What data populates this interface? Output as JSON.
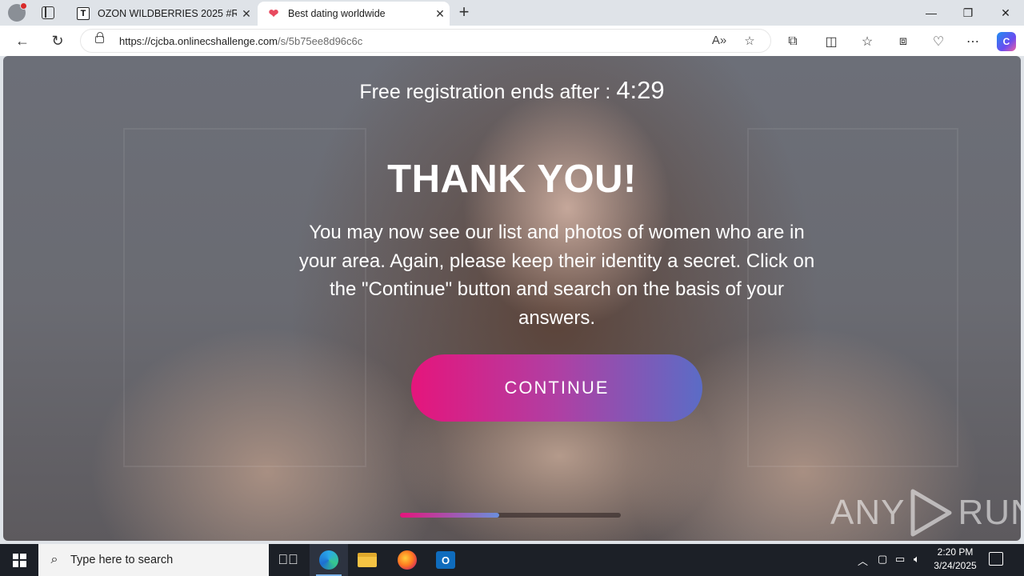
{
  "tabs": [
    {
      "favicon": "T",
      "title": "OZON WILDBERRIES 2025 #RVATI",
      "close": "✕"
    },
    {
      "favicon": "heart-icon",
      "title": "Best dating worldwide",
      "close": "✕"
    }
  ],
  "address": {
    "host": "https://cjcba.onlinecshallenge.com",
    "path": "/s/5b75ee8d96c6c"
  },
  "page": {
    "timer_label": "Free registration ends after : ",
    "timer_value": "4:29",
    "headline": "THANK YOU!",
    "message": "You may now see our list and photos of women who are in your area. Again, please keep their identity a secret. Click on the \"Continue\" button and search on the basis of your answers.",
    "cta_label": "CONTINUE",
    "progress_percent": 45
  },
  "watermark": {
    "left": "ANY",
    "right": "RUN"
  },
  "taskbar": {
    "search_placeholder": "Type here to search",
    "time": "2:20 PM",
    "date": "3/24/2025"
  },
  "colors": {
    "cta_start": "#e5157c",
    "cta_end": "#5b6cc6",
    "taskbar": "#1c2027"
  }
}
